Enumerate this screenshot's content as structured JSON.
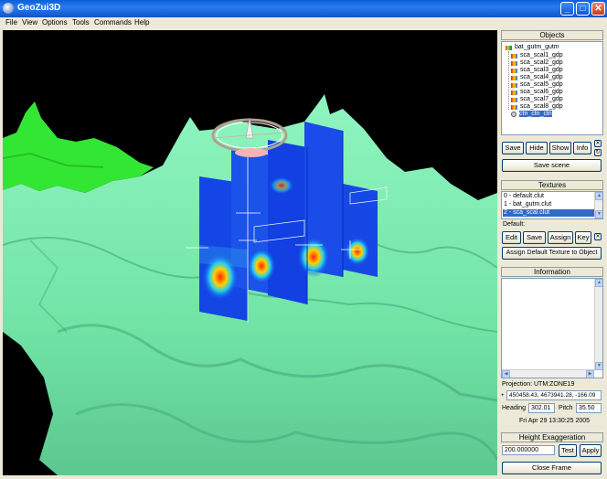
{
  "window": {
    "title": "GeoZui3D"
  },
  "menu": [
    "File",
    "View",
    "Options",
    "Tools",
    "Commands",
    "Help"
  ],
  "objects": {
    "header": "Objects",
    "root": "bat_gutm_gutm",
    "items": [
      "sca_scal1_gdp",
      "sca_scal2_gdp",
      "sca_scal3_gdp",
      "sca_scal4_gdp",
      "sca_scal5_gdp",
      "sca_scal6_gdp",
      "sca_scal7_gdp",
      "sca_scal8_gdp"
    ],
    "selected": "ctn_ctn_ctn",
    "buttons": {
      "save": "Save",
      "hide": "Hide",
      "show": "Show",
      "info": "Info",
      "save_scene": "Save scene"
    }
  },
  "textures": {
    "header": "Textures",
    "items": [
      "0 - default.clut",
      "1 - bat_gutm.clut",
      "2 - sca_scal.clut"
    ],
    "selected_index": 2,
    "default_label": "Default:",
    "buttons": {
      "edit": "Edit",
      "save": "Save",
      "assign": "Assign",
      "key": "Key",
      "assign_default": "Assign Default Texture to Object"
    }
  },
  "information": {
    "header": "Information",
    "projection_label": "Projection:",
    "projection_value": "UTM:ZONE19",
    "coordinates": "450458.43, 4673941.28, -166.09",
    "heading_label": "Heading",
    "heading_value": "302.01",
    "pitch_label": "Pitch",
    "pitch_value": "35.50",
    "datetime": "Fri Apr 29 13:30:25 2005"
  },
  "height_exaggeration": {
    "header": "Height Exaggeration",
    "value": "200.000000",
    "test_label": "Test",
    "apply_label": "Apply"
  },
  "close_frame_label": "Close Frame",
  "colors": {
    "terrain": "#7ff0b0",
    "terrain_shadow": "#3c9a72",
    "ridge": "#33e633",
    "panel_blue": "#1138e0",
    "hotspot": "#ff3010",
    "selection": "#316ac5"
  }
}
